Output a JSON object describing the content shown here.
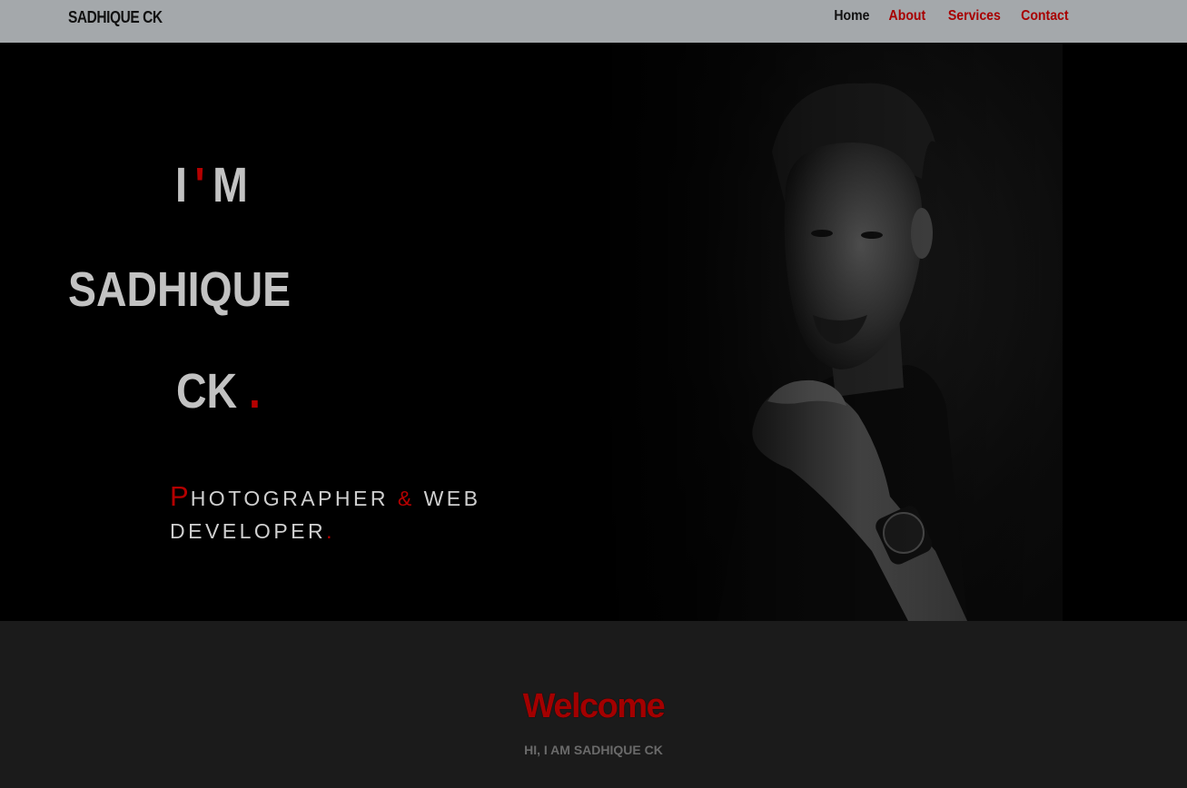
{
  "nav": {
    "brand": "SADHIQUE CK",
    "links": [
      "Home",
      "About",
      "Services",
      "Contact"
    ]
  },
  "hero": {
    "line1_a": "I",
    "line1_apostrophe": "'",
    "line1_b": "M",
    "line2": "SADHIQUE",
    "line3": "CK",
    "line3_period": ".",
    "tagline_cap": "P",
    "tagline_rest1": "HOTOGRAPHER",
    "tagline_amp": "&",
    "tagline_rest2": "WEB DEVELOPER",
    "tagline_period": "."
  },
  "welcome": {
    "title": "Welcome",
    "subtitle": "HI, I AM SADHIQUE CK"
  },
  "colors": {
    "accent": "#b50000",
    "navbar_bg": "#a4a8ab",
    "hero_bg": "#000000",
    "section_bg": "#1b1b1b"
  },
  "icons": {
    "portrait": "portrait-photo"
  }
}
